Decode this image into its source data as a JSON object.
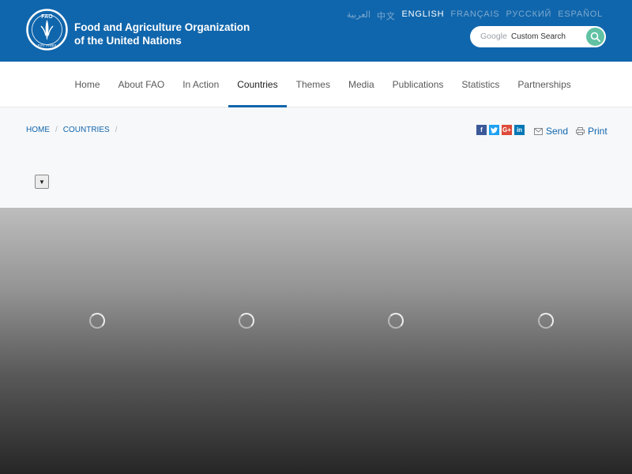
{
  "header": {
    "logo": {
      "letters": "FAO",
      "motto": "FIAT PANIS"
    },
    "org_name_line1": "Food and Agriculture Organization",
    "org_name_line2": "of the United Nations",
    "languages": [
      {
        "label": "العربية",
        "active": false
      },
      {
        "label": "中文",
        "active": false
      },
      {
        "label": "ENGLISH",
        "active": true
      },
      {
        "label": "FRANÇAIS",
        "active": false
      },
      {
        "label": "РУССКИЙ",
        "active": false
      },
      {
        "label": "ESPAÑOL",
        "active": false
      }
    ],
    "search": {
      "brand": "Google",
      "placeholder": "Custom Search",
      "icon": "magnifier-icon"
    }
  },
  "nav": {
    "items": [
      {
        "label": "Home",
        "active": false
      },
      {
        "label": "About FAO",
        "active": false
      },
      {
        "label": "In Action",
        "active": false
      },
      {
        "label": "Countries",
        "active": true
      },
      {
        "label": "Themes",
        "active": false
      },
      {
        "label": "Media",
        "active": false
      },
      {
        "label": "Publications",
        "active": false
      },
      {
        "label": "Statistics",
        "active": false
      },
      {
        "label": "Partnerships",
        "active": false
      }
    ]
  },
  "breadcrumb": {
    "items": [
      "HOME",
      "COUNTRIES"
    ],
    "separator": "/"
  },
  "share": {
    "facebook": "f",
    "twitter": "t",
    "googleplus": "G+",
    "linkedin": "in"
  },
  "actions": {
    "send": "Send",
    "print": "Print"
  },
  "dropdown": {
    "symbol": "▼"
  },
  "slider": {
    "slide_count": 4,
    "state": "loading"
  },
  "colors": {
    "brand_blue": "#1066ac",
    "search_green": "#61c2a3"
  }
}
